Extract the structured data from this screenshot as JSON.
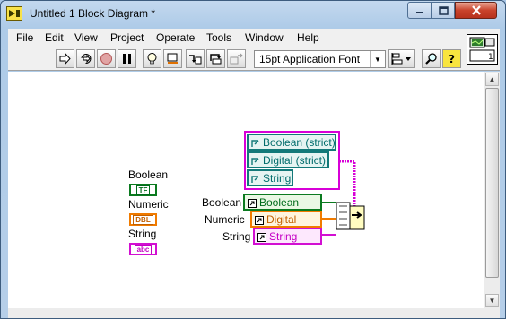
{
  "window": {
    "title": "Untitled 1 Block Diagram *"
  },
  "menu": [
    "File",
    "Edit",
    "View",
    "Project",
    "Operate",
    "Tools",
    "Window",
    "Help"
  ],
  "toolbar": {
    "font": "15pt Application Font",
    "buttons": [
      "run-arrow-icon",
      "run-continuously-icon",
      "abort-icon",
      "pause-icon",
      "highlight-execution-icon",
      "retain-wire-values-icon",
      "step-into-icon",
      "step-over-icon",
      "step-out-icon",
      "align-objects-icon",
      "search-icon",
      "help-icon"
    ]
  },
  "diagram": {
    "terminals": [
      {
        "label": "Boolean",
        "type": "TF",
        "color": "#0b7a1f"
      },
      {
        "label": "Numeric",
        "type": "DBL",
        "color": "#f07b00"
      },
      {
        "label": "String",
        "type": "abc",
        "color": "#d20fd2"
      }
    ],
    "property_nodes": [
      {
        "label": "Boolean",
        "value": "Boolean"
      },
      {
        "label": "Numeric",
        "value": "Digital"
      },
      {
        "label": "String",
        "value": "String"
      }
    ],
    "refs": [
      "Boolean (strict)",
      "Digital (strict)",
      "String"
    ]
  },
  "colors": {
    "boolean": "#0b7a1f",
    "numeric": "#f07b00",
    "string": "#d20fd2",
    "reference": "#137979",
    "cluster_wire": "#d700d7"
  }
}
